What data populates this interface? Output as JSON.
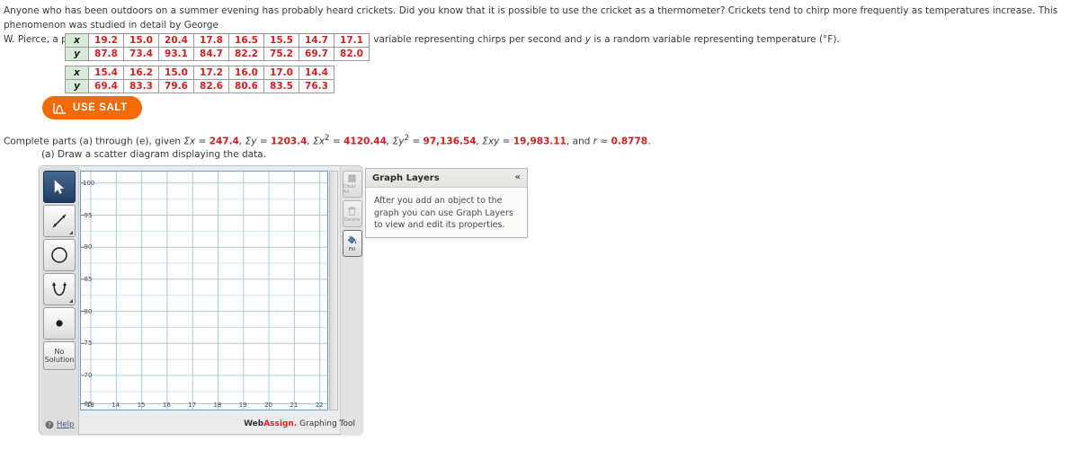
{
  "problem": {
    "paragraph_1": "Anyone who has been outdoors on a summer evening has probably heard crickets. Did you know that it is possible to use the cricket as a thermometer? Crickets tend to chirp more frequently as temperatures increase. This phenomenon was studied in detail by George",
    "paragraph_2_pre": "W. Pierce, a physics professor at Harvard. In the following data, ",
    "var_x": "x",
    "paragraph_2_mid": " is a random variable representing chirps per second and ",
    "var_y": "y",
    "paragraph_2_post": " is a random variable representing temperature (°F)."
  },
  "tables": [
    {
      "row_x_label": "x",
      "row_y_label": "y",
      "x_values": [
        "19.2",
        "15.0",
        "20.4",
        "17.8",
        "16.5",
        "15.5",
        "14.7",
        "17.1"
      ],
      "y_values": [
        "87.8",
        "73.4",
        "93.1",
        "84.7",
        "82.2",
        "75.2",
        "69.7",
        "82.0"
      ]
    },
    {
      "row_x_label": "x",
      "row_y_label": "y",
      "x_values": [
        "15.4",
        "16.2",
        "15.0",
        "17.2",
        "16.0",
        "17.0",
        "14.4"
      ],
      "y_values": [
        "69.4",
        "83.3",
        "79.6",
        "82.6",
        "80.6",
        "83.5",
        "76.3"
      ]
    }
  ],
  "salt_button": {
    "label": "USE SALT",
    "color": "#f26a00"
  },
  "given": {
    "lead": "Complete parts (a) through (e), given ",
    "sum_x_label": "Σx = ",
    "sum_x_value": "247.4",
    "sum_y_label": ", Σy = ",
    "sum_y_value": "1203.4",
    "sum_x2_label": ", Σx",
    "sum_x2_sup": "2",
    "sum_x2_eq": " = ",
    "sum_x2_value": "4120.44",
    "sum_y2_label": ", Σy",
    "sum_y2_sup": "2",
    "sum_y2_eq": " = ",
    "sum_y2_value": "97,136.54",
    "sum_xy_label": ", Σxy = ",
    "sum_xy_value": "19,983.11",
    "r_label": ", and ",
    "r_var": "r",
    "r_approx": " ≈ ",
    "r_value": "0.8778",
    "period": "."
  },
  "part_a": "(a) Draw a scatter diagram displaying the data.",
  "graph_tool": {
    "left_tools": [
      {
        "name": "select-tool",
        "label": "",
        "active": true
      },
      {
        "name": "line-tool",
        "label": "",
        "active": false
      },
      {
        "name": "circle-tool",
        "label": "",
        "active": false
      },
      {
        "name": "parabola-tool",
        "label": "",
        "active": false
      },
      {
        "name": "point-tool",
        "label": "",
        "active": false
      },
      {
        "name": "no-solution-button",
        "label": "No Solution",
        "active": false
      }
    ],
    "help_label": "Help",
    "right_tools": [
      {
        "name": "clear-all-button",
        "label": "Clear All",
        "enabled": false
      },
      {
        "name": "delete-button",
        "label": "Delete",
        "enabled": false
      },
      {
        "name": "fill-button",
        "label": "Fill",
        "enabled": true
      }
    ],
    "brand_prefix": "Web",
    "brand_accent": "Assign.",
    "brand_suffix": " Graphing Tool"
  },
  "layers_panel": {
    "title": "Graph Layers",
    "collapse_icon": "«",
    "body": "After you add an object to the graph you can use Graph Layers to view and edit its properties."
  },
  "chart_data": {
    "type": "scatter",
    "title": "",
    "xlabel": "",
    "ylabel": "",
    "xlim": [
      12.6,
      22.6
    ],
    "ylim": [
      64.2,
      100.5
    ],
    "x_ticks": [
      13,
      14,
      15,
      16,
      17,
      18,
      19,
      20,
      21,
      22
    ],
    "y_ticks": [
      65,
      70,
      75,
      80,
      85,
      90,
      95,
      100
    ],
    "grid": true,
    "legend": "none",
    "points": [],
    "note": "Empty graphing canvas - no data points plotted yet",
    "available_data": {
      "x": [
        19.2,
        15.0,
        20.4,
        17.8,
        16.5,
        15.5,
        14.7,
        17.1,
        15.4,
        16.2,
        15.0,
        17.2,
        16.0,
        17.0,
        14.4
      ],
      "y": [
        87.8,
        73.4,
        93.1,
        84.7,
        82.2,
        75.2,
        69.7,
        82.0,
        69.4,
        83.3,
        79.6,
        82.6,
        80.6,
        83.5,
        76.3
      ]
    }
  }
}
